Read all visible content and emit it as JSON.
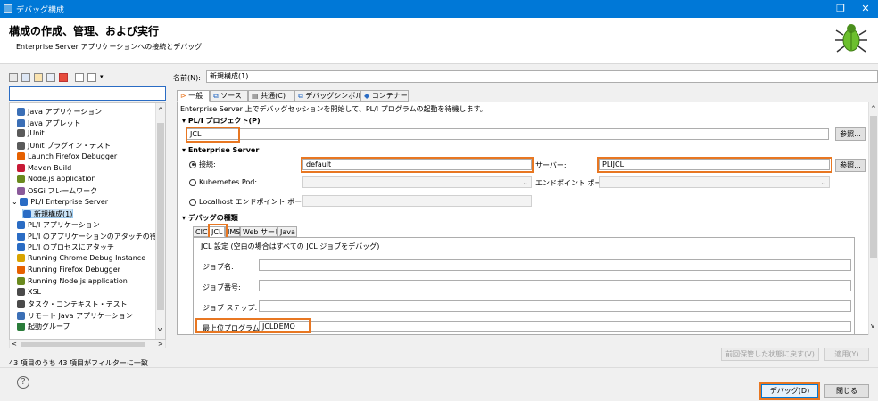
{
  "window": {
    "title": "デバッグ構成",
    "restore_glyph": "❐",
    "close_glyph": "✕"
  },
  "header": {
    "title": "構成の作成、管理、および実行",
    "subtitle": "Enterprise Server アプリケーションへの接続とデバッグ"
  },
  "sidebar": {
    "filter_value": "",
    "items": [
      {
        "label": "Java アプリケーション",
        "icon": "java-app-icon",
        "color": "#3b6fb6"
      },
      {
        "label": "Java アプレット",
        "icon": "java-applet-icon",
        "color": "#3b6fb6"
      },
      {
        "label": "JUnit",
        "icon": "junit-icon",
        "color": "#5a5a5a"
      },
      {
        "label": "JUnit プラグイン・テスト",
        "icon": "junit-plugin-icon",
        "color": "#5a5a5a"
      },
      {
        "label": "Launch Firefox Debugger",
        "icon": "firefox-icon",
        "color": "#e66000"
      },
      {
        "label": "Maven Build",
        "icon": "maven-icon",
        "color": "#c71a36"
      },
      {
        "label": "Node.js application",
        "icon": "nodejs-icon",
        "color": "#6a8a1e"
      },
      {
        "label": "OSGi フレームワーク",
        "icon": "osgi-icon",
        "color": "#8a5a9a"
      },
      {
        "label": "PL/I Enterprise Server",
        "icon": "pli-server-icon",
        "color": "#2a6cc4"
      },
      {
        "label": "新規構成(1)",
        "icon": "config-icon",
        "color": "#2a6cc4"
      },
      {
        "label": "PL/I アプリケーション",
        "icon": "pli-app-icon",
        "color": "#2a6cc4"
      },
      {
        "label": "PL/I のアプリケーションのアタッチの待",
        "icon": "pli-attach-icon",
        "color": "#2a6cc4"
      },
      {
        "label": "PL/I のプロセスにアタッチ",
        "icon": "pli-process-icon",
        "color": "#2a6cc4"
      },
      {
        "label": "Running Chrome Debug Instance",
        "icon": "chrome-icon",
        "color": "#d9a400"
      },
      {
        "label": "Running Firefox Debugger",
        "icon": "firefox-icon",
        "color": "#e66000"
      },
      {
        "label": "Running Node.js application",
        "icon": "nodejs-icon",
        "color": "#6a8a1e"
      },
      {
        "label": "XSL",
        "icon": "xsl-icon",
        "color": "#4a4a4a"
      },
      {
        "label": "タスク・コンテキスト・テスト",
        "icon": "task-icon",
        "color": "#4a4a4a"
      },
      {
        "label": "リモート Java アプリケーション",
        "icon": "remote-java-icon",
        "color": "#3b6fb6"
      },
      {
        "label": "起動グループ",
        "icon": "launch-group-icon",
        "color": "#2a7c3a"
      }
    ],
    "status": "43 項目のうち 43 項目がフィルターに一致"
  },
  "main": {
    "name_label": "名前(N):",
    "name_value": "新規構成(1)",
    "tabs": [
      "一般",
      "ソース",
      "共通(C)",
      "デバッグシンボル",
      "コンテナー"
    ],
    "description": "Enterprise Server 上でデバッグセッションを開始して、PL/I プログラムの起動を待機します。",
    "project_section": "PL/I プロジェクト(P)",
    "project_value": "JCL",
    "browse_label": "参照...",
    "es_section": "Enterprise Server",
    "connect_label": "接続:",
    "connect_value": "default",
    "server_label": "サーバー:",
    "server_value": "PLIJCL",
    "k8s_label": "Kubernetes Pod:",
    "endpoint_port_label": "エンドポイント ポート:",
    "localhost_label": "Localhost エンドポイント ポート:",
    "debug_type_section": "デバッグの種類",
    "debug_tabs": [
      "CICS",
      "JCL",
      "IMS",
      "Web サービス",
      "Java"
    ],
    "jcl_settings_label": "JCL 設定 (空白の場合はすべての JCL ジョブをデバッグ)",
    "job_name_label": "ジョブ名:",
    "job_number_label": "ジョブ番号:",
    "job_step_label": "ジョブ ステップ:",
    "top_program_label": "最上位プログラム:",
    "top_program_value": "JCLDEMO",
    "revert_label": "前回保管した状態に戻す(V)",
    "apply_label": "適用(Y)"
  },
  "footer": {
    "help_glyph": "?",
    "debug_label": "デバッグ(D)",
    "close_label": "閉じる"
  },
  "colors": {
    "title_bar": "#0078d7",
    "highlight": "#e87722",
    "selection": "#cce4f7"
  }
}
